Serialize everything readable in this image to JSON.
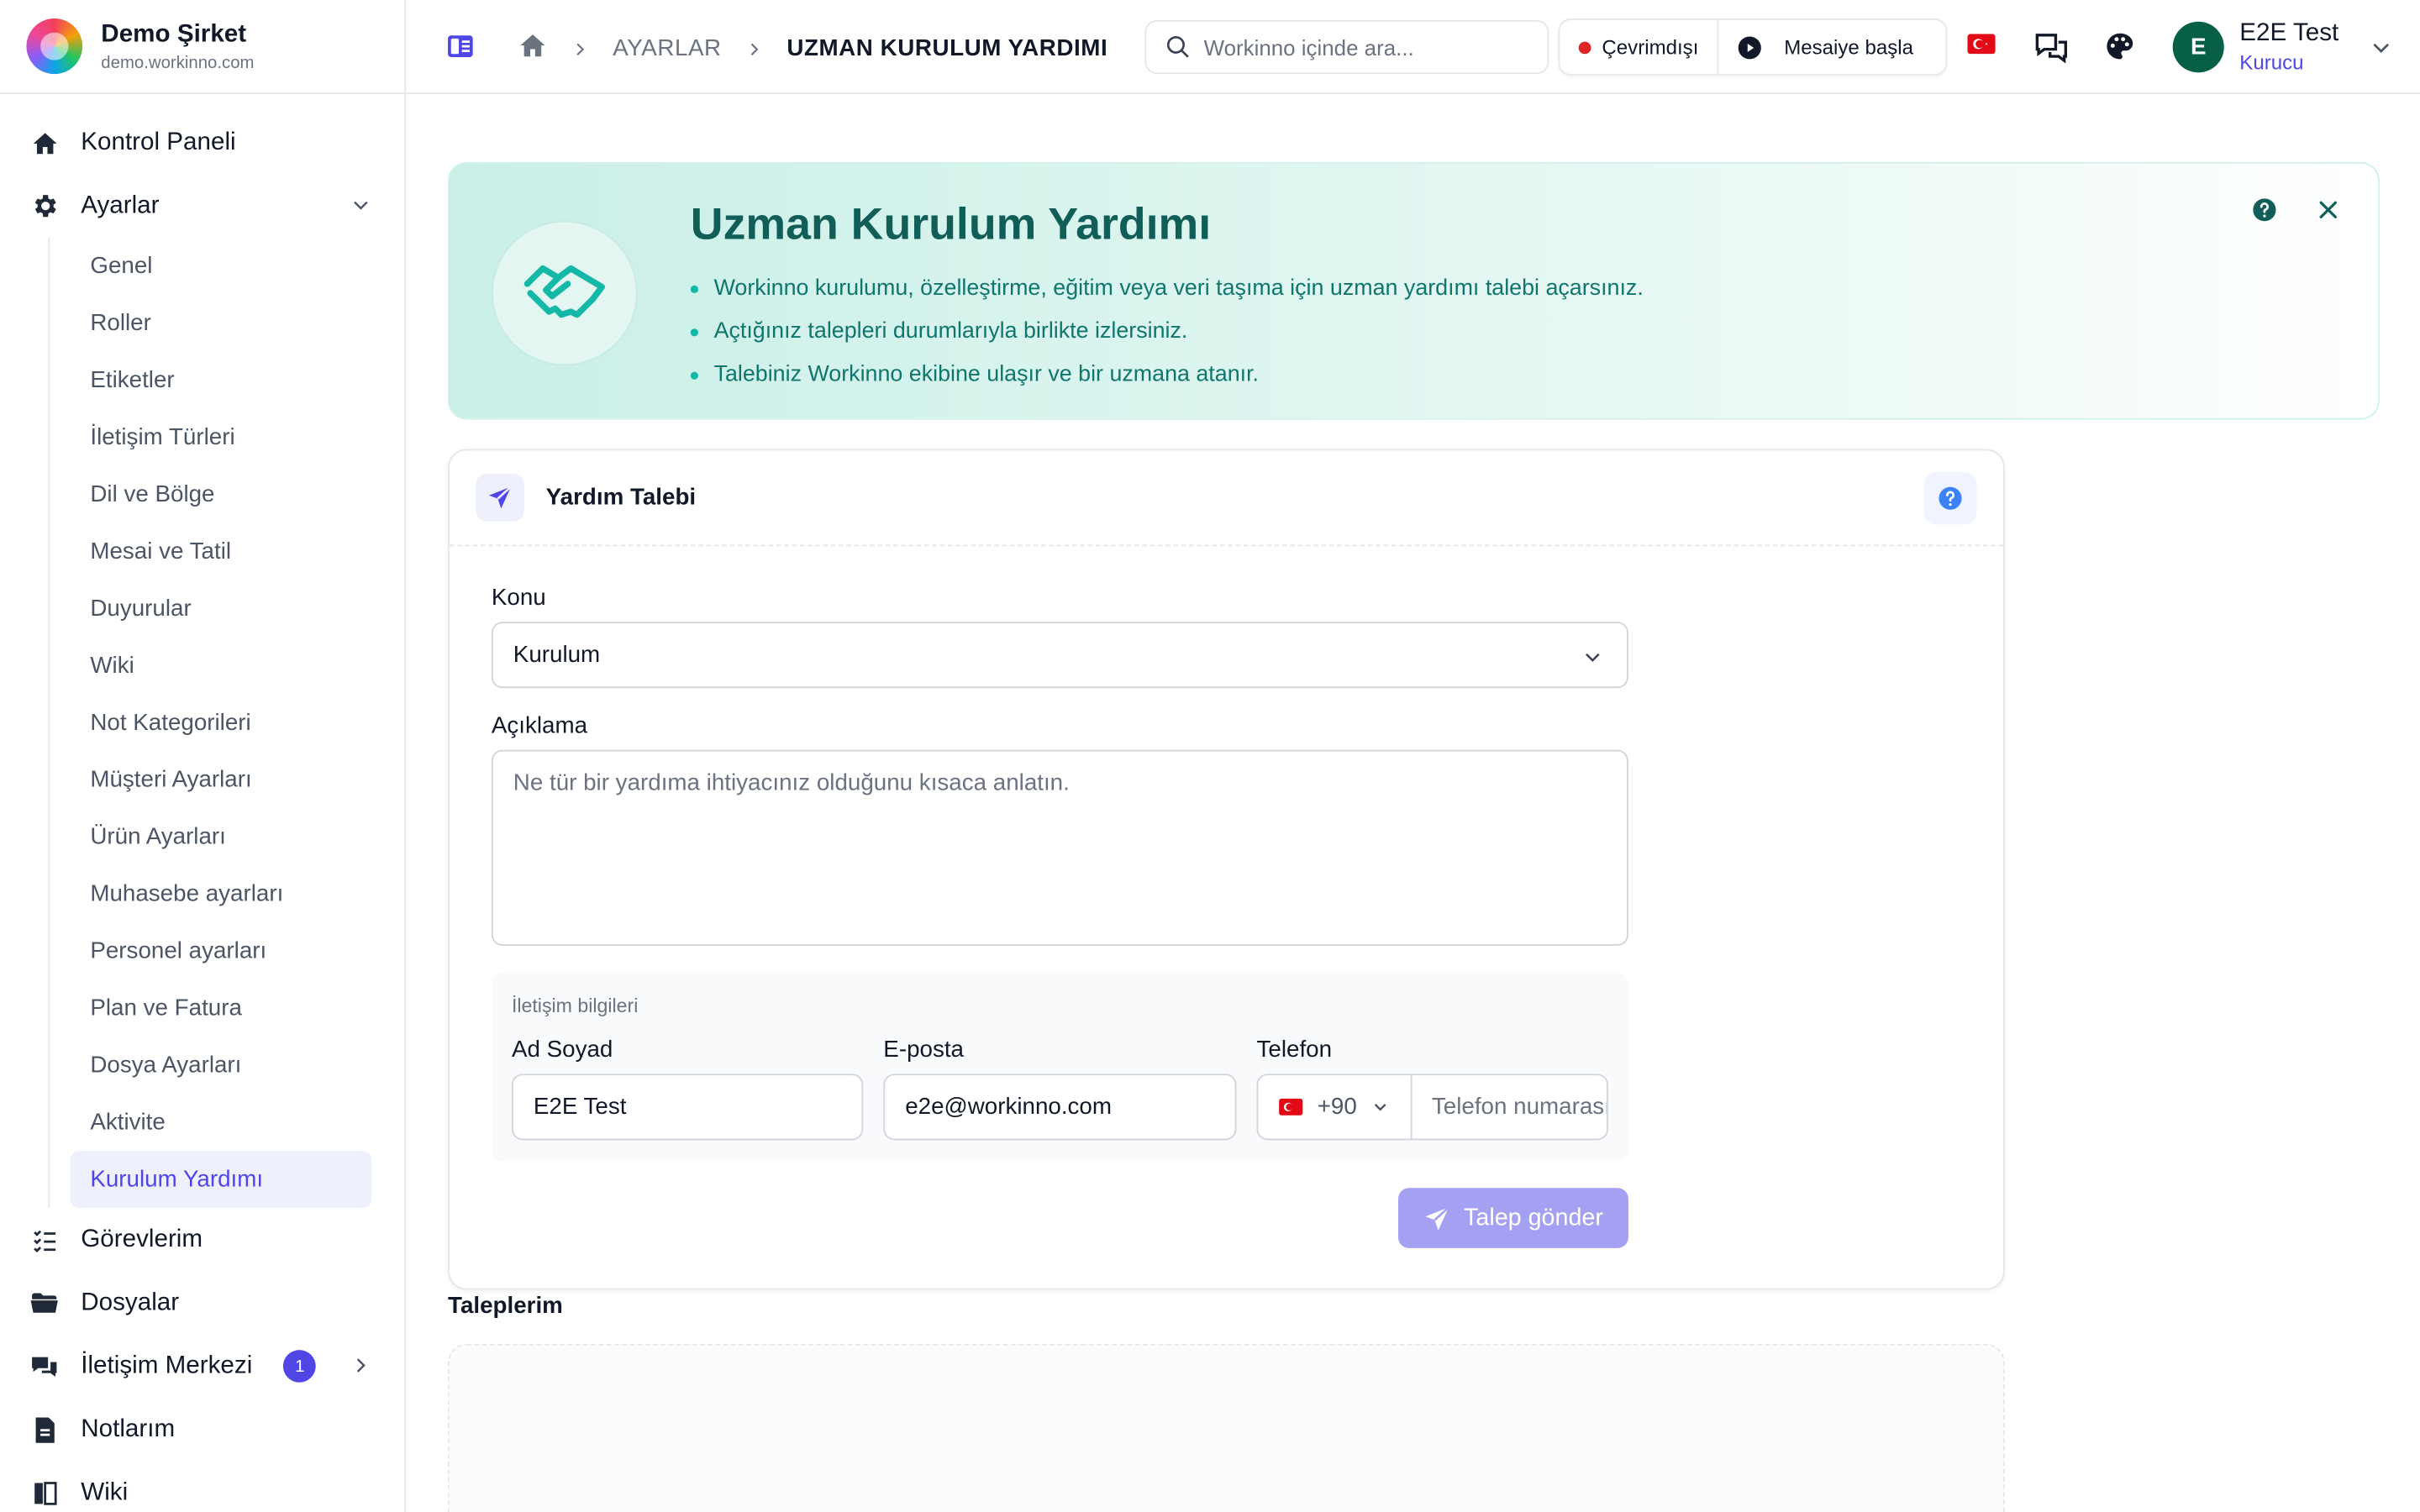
{
  "brand": {
    "name": "Demo Şirket",
    "domain": "demo.workinno.com"
  },
  "sidebar": {
    "top_items": [
      {
        "label": "Kontrol Paneli",
        "icon": "home-icon"
      },
      {
        "label": "Ayarlar",
        "icon": "gear-icon"
      }
    ],
    "settings_items": [
      "Genel",
      "Roller",
      "Etiketler",
      "İletişim Türleri",
      "Dil ve Bölge",
      "Mesai ve Tatil",
      "Duyurular",
      "Wiki",
      "Not Kategorileri",
      "Müşteri Ayarları",
      "Ürün Ayarları",
      "Muhasebe ayarları",
      "Personel ayarları",
      "Plan ve Fatura",
      "Dosya Ayarları",
      "Aktivite",
      "Kurulum Yardımı"
    ],
    "active_settings_item": "Kurulum Yardımı",
    "bottom_items": [
      {
        "label": "Görevlerim",
        "icon": "task-list-icon"
      },
      {
        "label": "Dosyalar",
        "icon": "folder-icon"
      },
      {
        "label": "İletişim Merkezi",
        "icon": "chat-icon",
        "badge": "1"
      },
      {
        "label": "Notlarım",
        "icon": "note-icon"
      },
      {
        "label": "Wiki",
        "icon": "book-icon"
      }
    ]
  },
  "topbar": {
    "breadcrumb": {
      "parent": "AYARLAR",
      "current": "UZMAN KURULUM YARDIMI"
    },
    "search_placeholder": "Workinno içinde ara...",
    "status_label": "Çevrimdışı",
    "start_shift_label": "Mesaiye başla",
    "user": {
      "initial": "E",
      "name": "E2E Test",
      "role": "Kurucu"
    }
  },
  "hero": {
    "title": "Uzman Kurulum Yardımı",
    "bullets": [
      "Workinno kurulumu, özelleştirme, eğitim veya veri taşıma için uzman yardımı talebi açarsınız.",
      "Açtığınız talepleri durumlarıyla birlikte izlersiniz.",
      "Talebiniz Workinno ekibine ulaşır ve bir uzmana atanır."
    ]
  },
  "form": {
    "title": "Yardım Talebi",
    "subject_label": "Konu",
    "subject_value": "Kurulum",
    "description_label": "Açıklama",
    "description_placeholder": "Ne tür bir yardıma ihtiyacınız olduğunu kısaca anlatın.",
    "contact_caption": "İletişim bilgileri",
    "name_label": "Ad Soyad",
    "name_value": "E2E Test",
    "email_label": "E-posta",
    "email_value": "e2e@workinno.com",
    "phone_label": "Telefon",
    "phone_code": "+90",
    "phone_placeholder": "Telefon numarası",
    "submit_label": "Talep gönder"
  },
  "requests": {
    "title": "Taleplerim"
  },
  "colors": {
    "accent": "#4f46e5",
    "teal": "#115e59",
    "offline": "#dc2626"
  }
}
